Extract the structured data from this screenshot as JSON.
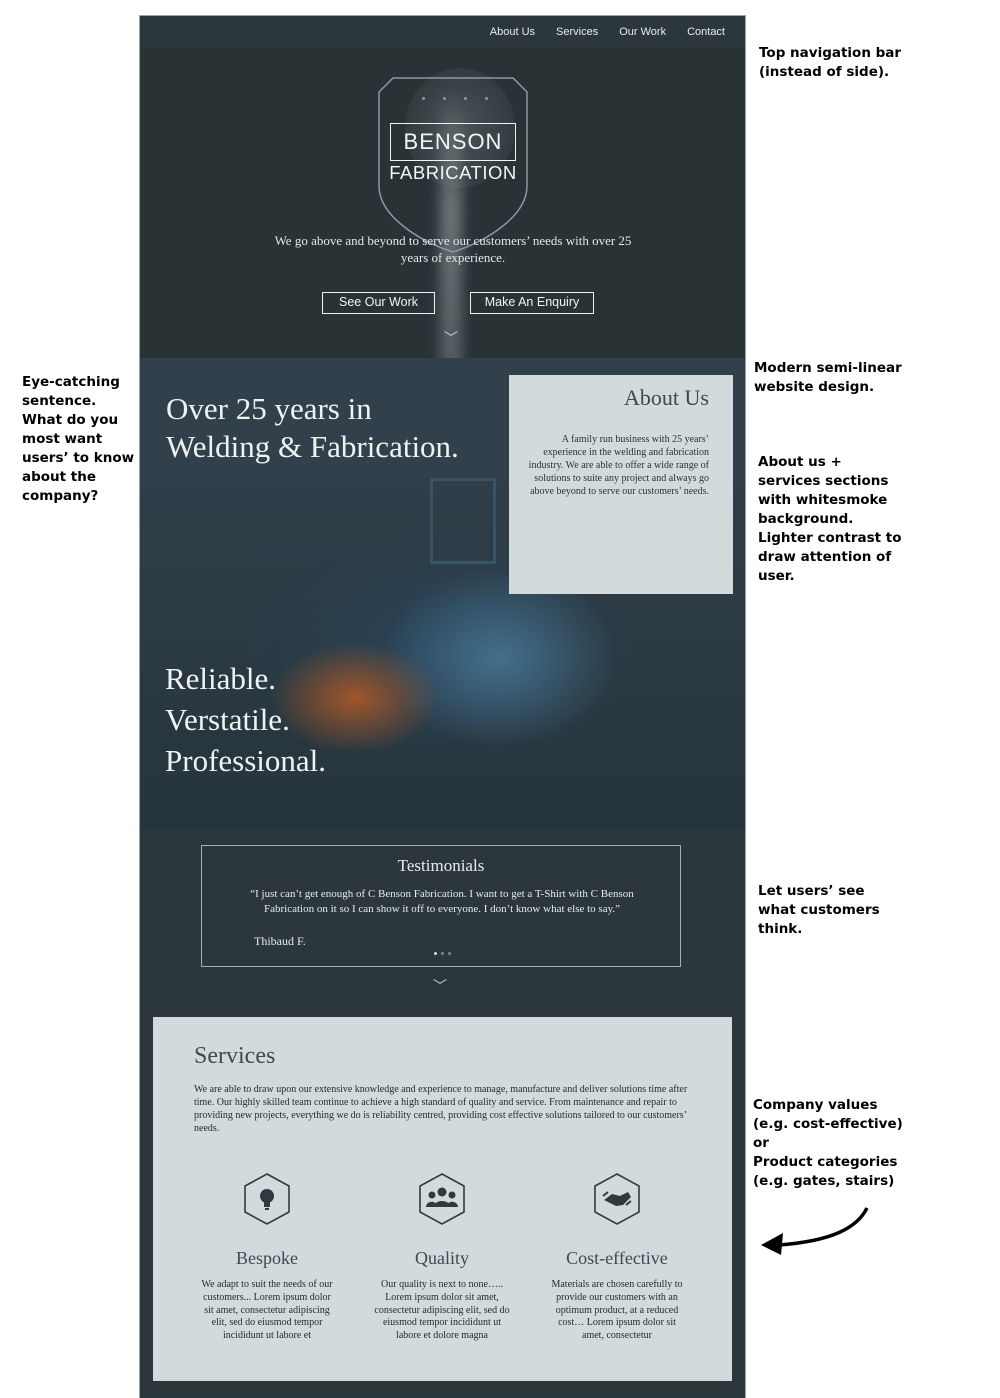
{
  "nav": {
    "items": [
      "About Us",
      "Services",
      "Our Work",
      "Contact"
    ]
  },
  "hero": {
    "brand_top": "BENSON",
    "brand_bottom": "FABRICATION",
    "tagline": "We go above and beyond to serve our customers’ needs with over 25 years of experience.",
    "btn_work": "See Our Work",
    "btn_enquiry": "Make An Enquiry"
  },
  "intro": {
    "headline": "Over 25 years in\nWelding & Fabrication.",
    "values": [
      "Reliable.",
      "Verstatile.",
      "Professional."
    ]
  },
  "about": {
    "title": "About Us",
    "body": "A family run business with 25 years’ experience in the welding and fabrication industry. We are able to offer a wide range of solutions to suite any project and always go above beyond to serve our customers’ needs."
  },
  "testimonials": {
    "title": "Testimonials",
    "quote": "“I just can’t get enough of C Benson Fabrication. I want to get a T-Shirt with C Benson Fabrication on it so I can show it off to everyone. I don’t know what else to say.”",
    "author": "Thibaud F."
  },
  "services": {
    "title": "Services",
    "intro": "We are able to draw upon our extensive knowledge and experience to manage, manufacture and deliver solutions time after time. Our highly skilled team continue to achieve a high standard of quality and service. From maintenance and repair to providing new projects, everything we do is reliability centred, providing cost effective solutions tailored to our customers’ needs.",
    "items": [
      {
        "title": "Bespoke",
        "icon": "lightbulb-icon",
        "text": "We adapt to suit the needs of our customers... Lorem ipsum dolor sit amet, consectetur adipiscing elit, sed do eiusmod tempor incididunt ut labore et"
      },
      {
        "title": "Quality",
        "icon": "people-icon",
        "text": "Our quality is next to none….. Lorem ipsum dolor sit amet, consectetur adipiscing elit, sed do eiusmod tempor incididunt ut labore et dolore magna"
      },
      {
        "title": "Cost-effective",
        "icon": "handshake-icon",
        "text": "Materials are chosen carefully to provide our customers with an optimum product, at a reduced cost… Lorem ipsum dolor sit amet, consectetur"
      }
    ]
  },
  "annotations": {
    "nav": "Top navigation bar\n(instead of side).",
    "eye": "Eye-catching\nsentence.\nWhat do you\nmost want\nusers’ to know\nabout the\ncompany?",
    "modern": "Modern semi-linear\nwebsite design.",
    "about": "About us +\nservices sections\nwith whitesmoke\nbackground.\nLighter contrast to\ndraw attention of\nuser.",
    "testimonials": "Let users’ see\nwhat customers\nthink.",
    "values": "Company values\n(e.g. cost-effective)\nor\nProduct categories\n(e.g. gates, stairs)"
  },
  "colors": {
    "dark": "#2c373c",
    "panel": "#d3dadc",
    "text_light": "#eef2f3"
  }
}
